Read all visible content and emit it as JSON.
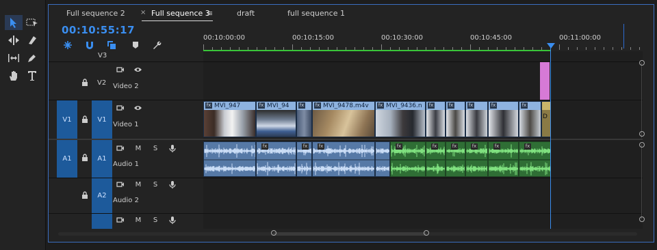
{
  "tabs": [
    "Full sequence 2",
    "Full sequence 3",
    "draft",
    "full sequence 1"
  ],
  "timecode": "00:10:55:17",
  "ruler": [
    "00:10:00:00",
    "00:10:15:00",
    "00:10:30:00",
    "00:10:45:00",
    "00:11:00:00"
  ],
  "tracks": {
    "v3": "V3",
    "v2": "V2",
    "v2_name": "Video 2",
    "v1_src": "V1",
    "v1": "V1",
    "v1_name": "Video 1",
    "a1_src": "A1",
    "a1": "A1",
    "a1_name": "Audio 1",
    "a2": "A2",
    "a2_name": "Audio 2",
    "m": "M",
    "s": "S"
  },
  "clips": {
    "c1": "MVI_947",
    "c2": "MVI_94",
    "c3": "MVI_9478.m4v",
    "c4": "MVI_9436.n",
    "fx": "fx",
    "end_marker": "D"
  },
  "colors": {
    "accent": "#3a8ef0",
    "video_clip": "#8eb3e0",
    "audio_blue": "#5679a6",
    "audio_green": "#2f6e35",
    "work_area": "#39c439",
    "pink_clip": "#d67ad6"
  }
}
